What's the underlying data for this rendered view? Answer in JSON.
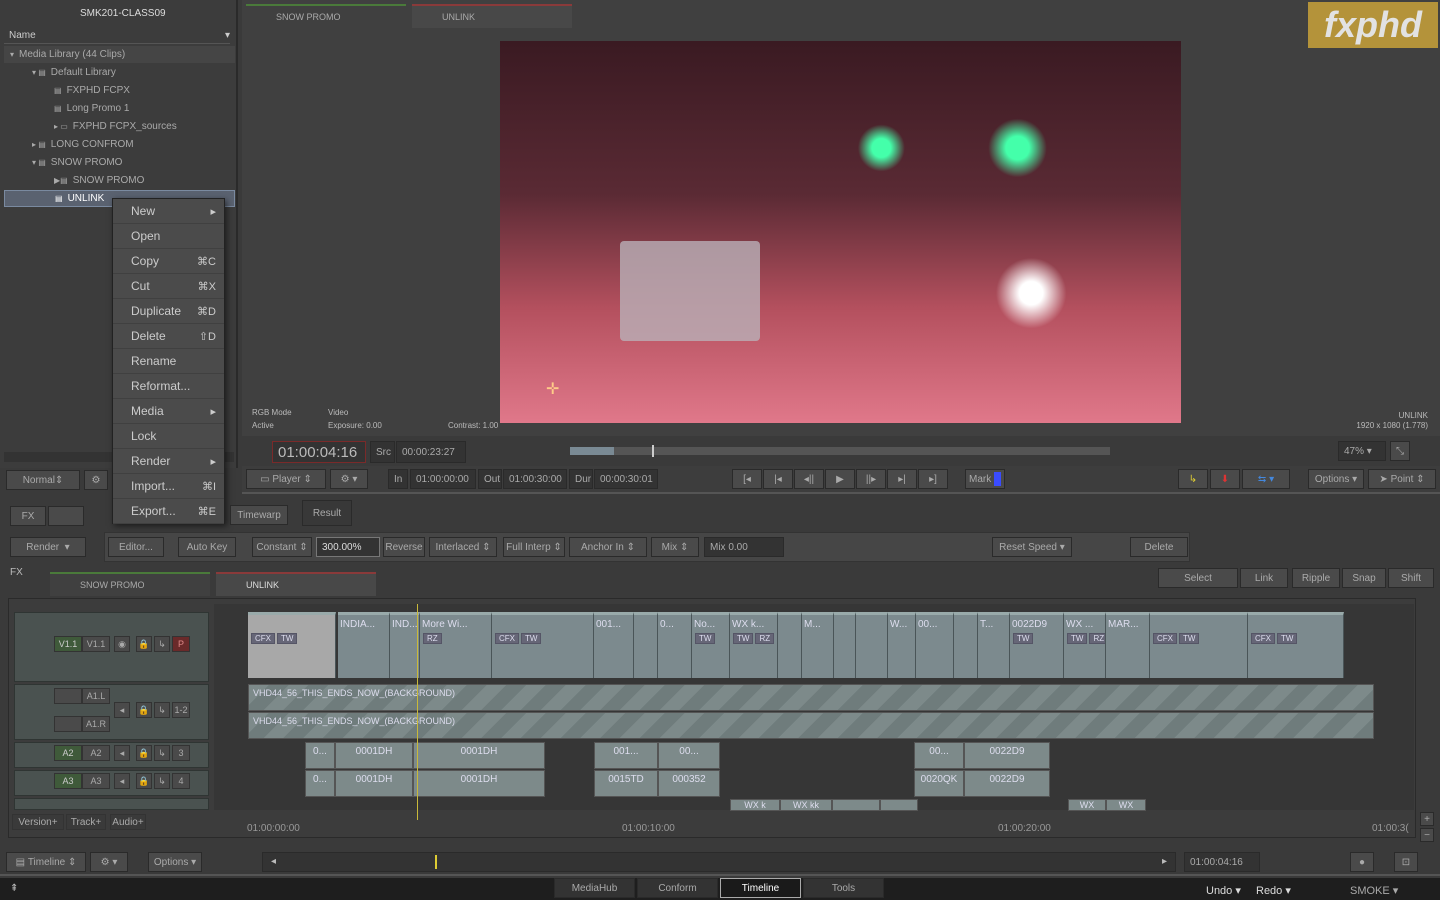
{
  "library": {
    "project": "SMK201-CLASS09",
    "column": "Name",
    "items": [
      {
        "label": "Media Library (44 Clips)",
        "indent": 0
      },
      {
        "label": "Default Library",
        "indent": 1
      },
      {
        "label": "FXPHD FCPX",
        "indent": 2
      },
      {
        "label": "Long Promo 1",
        "indent": 2
      },
      {
        "label": "FXPHD FCPX_sources",
        "indent": 2
      },
      {
        "label": "LONG CONFROM",
        "indent": 1
      },
      {
        "label": "SNOW PROMO",
        "indent": 1
      },
      {
        "label": "SNOW PROMO",
        "indent": 2
      },
      {
        "label": "UNLINK",
        "indent": 2,
        "selected": true
      }
    ],
    "view_mode": "Normal"
  },
  "context_menu": [
    {
      "label": "New",
      "shortcut": "",
      "submenu": true
    },
    {
      "label": "Open",
      "shortcut": ""
    },
    {
      "label": "Copy",
      "shortcut": "⌘C"
    },
    {
      "label": "Cut",
      "shortcut": "⌘X"
    },
    {
      "label": "Duplicate",
      "shortcut": "⌘D"
    },
    {
      "label": "Delete",
      "shortcut": "⇧D"
    },
    {
      "label": "Rename",
      "shortcut": ""
    },
    {
      "label": "Reformat...",
      "shortcut": ""
    },
    {
      "label": "Media",
      "shortcut": "",
      "submenu": true
    },
    {
      "label": "Lock",
      "shortcut": ""
    },
    {
      "label": "Render",
      "shortcut": "",
      "submenu": true
    },
    {
      "label": "Import...",
      "shortcut": "⌘I"
    },
    {
      "label": "Export...",
      "shortcut": "⌘E"
    }
  ],
  "viewer": {
    "tabs": [
      "SNOW PROMO",
      "UNLINK"
    ],
    "rgb_mode": "RGB Mode",
    "active": "Active",
    "video": "Video",
    "exposure": "Exposure: 0.00",
    "contrast": "Contrast: 1.00",
    "clip_name": "UNLINK",
    "resolution": "1920 x 1080 (1.778)",
    "logo": "fxphd",
    "zoom": "47%"
  },
  "transport": {
    "timecode": "01:00:04:16",
    "src_label": "Src",
    "src": "00:00:23:27",
    "player": "Player",
    "in_label": "In",
    "in": "01:00:00:00",
    "out_label": "Out",
    "out": "01:00:30:00",
    "dur_label": "Dur",
    "dur": "00:00:30:01",
    "mark": "Mark",
    "options": "Options",
    "point": "Point",
    "mark_color": "#3a4cff"
  },
  "fx": {
    "fx": "FX",
    "render": "Render",
    "fx_toggle": "FX",
    "editor": "Editor...",
    "auto_key": "Auto Key",
    "tabs": [
      "Timewarp",
      "Result"
    ],
    "mode": "Constant",
    "speed": "300.00%",
    "reverse": "Reverse",
    "interlaced": "Interlaced",
    "interp": "Full Interp",
    "anchor": "Anchor In",
    "mix": "Mix",
    "mix_value": "Mix 0.00",
    "reset_speed": "Reset Speed",
    "delete": "Delete"
  },
  "timeline": {
    "tabs": [
      "SNOW PROMO",
      "UNLINK"
    ],
    "tools": [
      "Select",
      "Link",
      "Ripple",
      "Snap",
      "Shift"
    ],
    "tracks": [
      {
        "src": "V1.1",
        "dst": "V1.1",
        "num": "P"
      },
      {
        "src": "",
        "dst": "A1.L",
        "num": "1-2"
      },
      {
        "src": "",
        "dst": "A1.R",
        "num": ""
      },
      {
        "src": "A2",
        "dst": "A2",
        "num": "3"
      },
      {
        "src": "A3",
        "dst": "A3",
        "num": "4"
      }
    ],
    "v1": [
      "",
      "INDIA...",
      "IND...",
      "More Wi...",
      "",
      "001...",
      "",
      "0...",
      "No...",
      "WX k...",
      "",
      "M...",
      "",
      "",
      "W...",
      "00...",
      "",
      "T...",
      "0022D9",
      "WX ...",
      "MAR...",
      "",
      ""
    ],
    "audio_name": "VHD44_56_THIS_ENDS_NOW_(BACKGROUND)",
    "a2": [
      "0...",
      "0001DH",
      "0001DH",
      "001...",
      "00...",
      "00...",
      "0022D9"
    ],
    "a3": [
      "0...",
      "0001DH",
      "0001DH",
      "0015TD",
      "000352",
      "0020QK",
      "0022D9"
    ],
    "a4": [
      "WX k",
      "WX kk",
      "",
      "",
      "WX",
      "WX"
    ],
    "ruler": [
      "01:00:00:00",
      "01:00:10:00",
      "01:00:20:00",
      "01:00:3("
    ],
    "buttons": [
      "Version+",
      "Track+",
      "Audio+"
    ],
    "view": "Timeline",
    "options": "Options",
    "current": "01:00:04:16"
  },
  "bottom": {
    "tabs": [
      "MediaHub",
      "Conform",
      "Timeline",
      "Tools"
    ],
    "active_tab": "Timeline",
    "undo": "Undo",
    "redo": "Redo",
    "app": "SMOKE"
  }
}
